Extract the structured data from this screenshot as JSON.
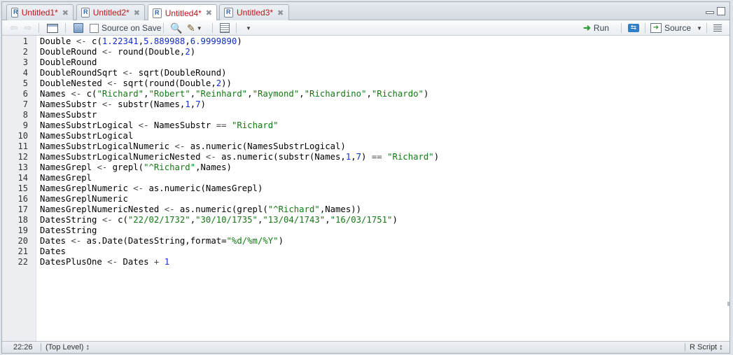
{
  "tabs": [
    {
      "label": "Untitled1*",
      "active": false
    },
    {
      "label": "Untitled2*",
      "active": false
    },
    {
      "label": "Untitled4*",
      "active": true
    },
    {
      "label": "Untitled3*",
      "active": false
    }
  ],
  "toolbar": {
    "source_on_save_label": "Source on Save",
    "source_on_save_checked": false,
    "run_label": "Run",
    "source_label": "Source"
  },
  "editor": {
    "lines": [
      {
        "n": "1",
        "tokens": [
          [
            "",
            "Double "
          ],
          [
            "op",
            "<- "
          ],
          [
            "",
            "c("
          ],
          [
            "num",
            "1.22341"
          ],
          [
            "",
            ","
          ],
          [
            "num",
            "5.889988"
          ],
          [
            "",
            ","
          ],
          [
            "num",
            "6.9999890"
          ],
          [
            "",
            ")"
          ]
        ]
      },
      {
        "n": "2",
        "tokens": [
          [
            "",
            "DoubleRound "
          ],
          [
            "op",
            "<- "
          ],
          [
            "",
            "round(Double,"
          ],
          [
            "num",
            "2"
          ],
          [
            "",
            ")"
          ]
        ]
      },
      {
        "n": "3",
        "tokens": [
          [
            "",
            "DoubleRound"
          ]
        ]
      },
      {
        "n": "4",
        "tokens": [
          [
            "",
            "DoubleRoundSqrt "
          ],
          [
            "op",
            "<- "
          ],
          [
            "",
            "sqrt(DoubleRound)"
          ]
        ]
      },
      {
        "n": "5",
        "tokens": [
          [
            "",
            "DoubleNested "
          ],
          [
            "op",
            "<- "
          ],
          [
            "",
            "sqrt(round(Double,"
          ],
          [
            "num",
            "2"
          ],
          [
            "",
            "))"
          ]
        ]
      },
      {
        "n": "6",
        "tokens": [
          [
            "",
            "Names "
          ],
          [
            "op",
            "<- "
          ],
          [
            "",
            "c("
          ],
          [
            "str",
            "\"Richard\""
          ],
          [
            "",
            ","
          ],
          [
            "str",
            "\"Robert\""
          ],
          [
            "",
            ","
          ],
          [
            "str",
            "\"Reinhard\""
          ],
          [
            "",
            ","
          ],
          [
            "str",
            "\"Raymond\""
          ],
          [
            "",
            ","
          ],
          [
            "str",
            "\"Richardino\""
          ],
          [
            "",
            ","
          ],
          [
            "str",
            "\"Richardo\""
          ],
          [
            "",
            ")"
          ]
        ]
      },
      {
        "n": "7",
        "tokens": [
          [
            "",
            "NamesSubstr "
          ],
          [
            "op",
            "<- "
          ],
          [
            "",
            "substr(Names,"
          ],
          [
            "num",
            "1"
          ],
          [
            "",
            ","
          ],
          [
            "num",
            "7"
          ],
          [
            "",
            ")"
          ]
        ]
      },
      {
        "n": "8",
        "tokens": [
          [
            "",
            "NamesSubstr"
          ]
        ]
      },
      {
        "n": "9",
        "tokens": [
          [
            "",
            "NamesSubstrLogical "
          ],
          [
            "op",
            "<- "
          ],
          [
            "",
            "NamesSubstr "
          ],
          [
            "op",
            "== "
          ],
          [
            "str",
            "\"Richard\""
          ]
        ]
      },
      {
        "n": "10",
        "tokens": [
          [
            "",
            "NamesSubstrLogical"
          ]
        ]
      },
      {
        "n": "11",
        "tokens": [
          [
            "",
            "NamesSubstrLogicalNumeric "
          ],
          [
            "op",
            "<- "
          ],
          [
            "",
            "as.numeric(NamesSubstrLogical)"
          ]
        ]
      },
      {
        "n": "12",
        "tokens": [
          [
            "",
            "NamesSubstrLogicalNumericNested "
          ],
          [
            "op",
            "<- "
          ],
          [
            "",
            "as.numeric(substr(Names,"
          ],
          [
            "num",
            "1"
          ],
          [
            "",
            ","
          ],
          [
            "num",
            "7"
          ],
          [
            "",
            ") "
          ],
          [
            "op",
            "== "
          ],
          [
            "str",
            "\"Richard\""
          ],
          [
            "",
            ")"
          ]
        ]
      },
      {
        "n": "13",
        "tokens": [
          [
            "",
            "NamesGrepl "
          ],
          [
            "op",
            "<- "
          ],
          [
            "",
            "grepl("
          ],
          [
            "str",
            "\"^Richard\""
          ],
          [
            "",
            ",Names)"
          ]
        ]
      },
      {
        "n": "14",
        "tokens": [
          [
            "",
            "NamesGrepl"
          ]
        ]
      },
      {
        "n": "15",
        "tokens": [
          [
            "",
            "NamesGreplNumeric "
          ],
          [
            "op",
            "<- "
          ],
          [
            "",
            "as.numeric(NamesGrepl)"
          ]
        ]
      },
      {
        "n": "16",
        "tokens": [
          [
            "",
            "NamesGreplNumeric"
          ]
        ]
      },
      {
        "n": "17",
        "tokens": [
          [
            "",
            "NamesGreplNumericNested "
          ],
          [
            "op",
            "<- "
          ],
          [
            "",
            "as.numeric(grepl("
          ],
          [
            "str",
            "\"^Richard\""
          ],
          [
            "",
            ",Names))"
          ]
        ]
      },
      {
        "n": "18",
        "tokens": [
          [
            "",
            "DatesString "
          ],
          [
            "op",
            "<- "
          ],
          [
            "",
            "c("
          ],
          [
            "str",
            "\"22/02/1732\""
          ],
          [
            "",
            ","
          ],
          [
            "str",
            "\"30/10/1735\""
          ],
          [
            "",
            ","
          ],
          [
            "str",
            "\"13/04/1743\""
          ],
          [
            "",
            ","
          ],
          [
            "str",
            "\"16/03/1751\""
          ],
          [
            "",
            ")"
          ]
        ]
      },
      {
        "n": "19",
        "tokens": [
          [
            "",
            "DatesString"
          ]
        ]
      },
      {
        "n": "20",
        "tokens": [
          [
            "",
            "Dates "
          ],
          [
            "op",
            "<- "
          ],
          [
            "",
            "as.Date(DatesString,format="
          ],
          [
            "str",
            "\"%d/%m/%Y\""
          ],
          [
            "",
            ")"
          ]
        ]
      },
      {
        "n": "21",
        "tokens": [
          [
            "",
            "Dates"
          ]
        ]
      },
      {
        "n": "22",
        "tokens": [
          [
            "",
            "DatesPlusOne "
          ],
          [
            "op",
            "<- "
          ],
          [
            "",
            "Dates "
          ],
          [
            "op",
            "+ "
          ],
          [
            "num",
            "1"
          ]
        ]
      }
    ]
  },
  "status": {
    "cursor": "22:26",
    "scope": "(Top Level) ↕",
    "file_type": "R Script ↕"
  },
  "colors": {
    "tab_text": "#b8161b",
    "string": "#127a12",
    "number": "#1030c8"
  }
}
